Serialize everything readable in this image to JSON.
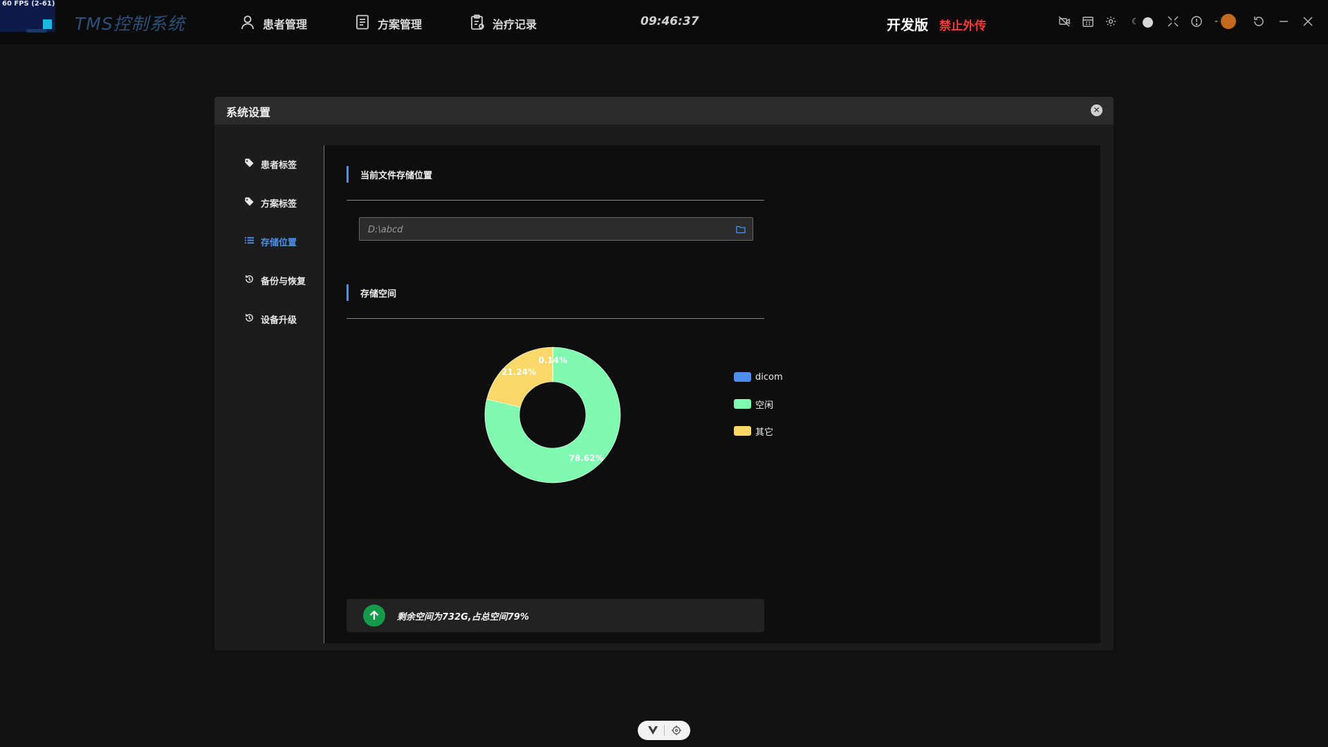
{
  "topbar": {
    "fps": "60 FPS (2-61)",
    "app_title": "TMS控制系统",
    "nav": [
      {
        "label": "患者管理",
        "icon": "user-icon"
      },
      {
        "label": "方案管理",
        "icon": "document-icon"
      },
      {
        "label": "治疗记录",
        "icon": "clipboard-icon"
      }
    ],
    "clock": "09:46:37",
    "edition": "开发版",
    "no_share": "禁止外传",
    "window_icons": [
      "camera-off-icon",
      "calendar-icon",
      "gear-icon",
      "theme-toggle",
      "fullscreen-icon",
      "info-icon",
      "avatar",
      "refresh-icon",
      "minimize-icon",
      "close-icon"
    ],
    "avatar_dash": "-"
  },
  "dialog": {
    "title": "系统设置",
    "close_icon": "close-circle-icon",
    "menu": [
      {
        "label": "患者标签",
        "icon": "tag-icon",
        "active": false
      },
      {
        "label": "方案标签",
        "icon": "tag-icon",
        "active": false
      },
      {
        "label": "存储位置",
        "icon": "list-icon",
        "active": true
      },
      {
        "label": "备份与恢复",
        "icon": "history-icon",
        "active": false
      },
      {
        "label": "设备升级",
        "icon": "history-icon",
        "active": false
      }
    ],
    "section_storage_path": "当前文件存储位置",
    "path_value": "D:\\abcd",
    "section_space": "存储空间",
    "chart_data": {
      "type": "pie",
      "title": "",
      "series": [
        {
          "name": "dicom",
          "value": 0.14,
          "label": "0.14%",
          "color": "#4b8df0"
        },
        {
          "name": "空闲",
          "value": 78.62,
          "label": "78.62%",
          "color": "#7ffab0"
        },
        {
          "name": "其它",
          "value": 21.24,
          "label": "21.24%",
          "color": "#fcd86a"
        }
      ],
      "legend_position": "right"
    },
    "info_text": "剩余空间为732G,占总空间79%",
    "info_icon": "arrow-up-icon"
  },
  "colors": {
    "accent": "#4d90ea",
    "danger": "#ff3b3b",
    "success": "#149a4a"
  }
}
